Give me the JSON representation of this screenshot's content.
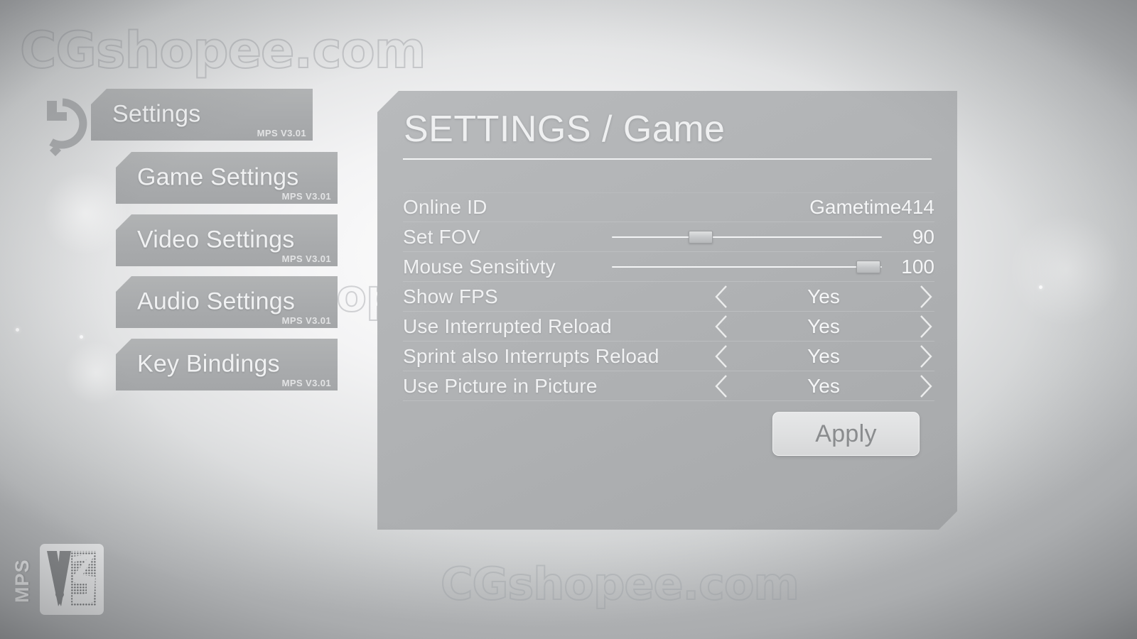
{
  "watermarks": {
    "top": "CGshopee.com",
    "middle": "CGshopee.com",
    "bottom": "CGshopee.com"
  },
  "back": {
    "label": "back-arrow"
  },
  "sidebar": {
    "version_tag": "MPS V3.01",
    "items": [
      {
        "label": "Settings",
        "version": "MPS V3.01",
        "active": true
      },
      {
        "label": "Game Settings",
        "version": "MPS V3.01",
        "active": false
      },
      {
        "label": "Video Settings",
        "version": "MPS V3.01",
        "active": false
      },
      {
        "label": "Audio Settings",
        "version": "MPS V3.01",
        "active": false
      },
      {
        "label": "Key Bindings",
        "version": "MPS V3.01",
        "active": false
      }
    ]
  },
  "panel": {
    "title": "SETTINGS / Game",
    "rows": [
      {
        "type": "text",
        "name": "Online ID",
        "value": "Gametime414"
      },
      {
        "type": "slider",
        "name": "Set FOV",
        "value": "90",
        "percent": 33
      },
      {
        "type": "slider",
        "name": "Mouse Sensitivty",
        "value": "100",
        "percent": 95
      },
      {
        "type": "select",
        "name": "Show FPS",
        "value": "Yes",
        "left_icon": "chevron-left-icon",
        "right_icon": "chevron-right-icon"
      },
      {
        "type": "select",
        "name": "Use Interrupted Reload",
        "value": "Yes",
        "left_icon": "chevron-left-icon",
        "right_icon": "chevron-right-icon"
      },
      {
        "type": "select",
        "name": "Sprint also Interrupts Reload",
        "value": "Yes",
        "left_icon": "chevron-left-icon",
        "right_icon": "chevron-right-icon"
      },
      {
        "type": "select",
        "name": "Use Picture in Picture",
        "value": "Yes",
        "left_icon": "chevron-left-icon",
        "right_icon": "chevron-right-icon"
      }
    ],
    "apply_label": "Apply"
  },
  "logo": {
    "brand": "MPS",
    "badge": "V3"
  },
  "colors": {
    "panel_fill": "#b2b4b6",
    "button_fill": "#a9abad",
    "text_light": "#f1f2f3",
    "apply_text": "#8a8c8e",
    "background_light": "#f4f4f5"
  }
}
